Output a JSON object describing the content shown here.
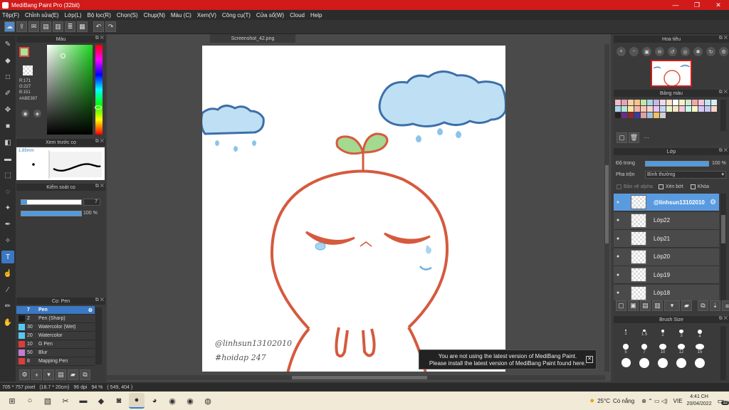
{
  "window": {
    "title": "MediBang Paint Pro (32bit)",
    "minimize": "—",
    "maximize": "❐",
    "close": "✕"
  },
  "menu": [
    "Tệp(F)",
    "Chỉnh sửa(E)",
    "Lớp(L)",
    "Bộ lọc(R)",
    "Chọn(S)",
    "Chụp(N)",
    "Màu (C)",
    "Xem(V)",
    "Công cụ(T)",
    "Cửa sổ(W)",
    "Cloud",
    "Help"
  ],
  "color_panel": {
    "title": "Màu",
    "r": "R:171",
    "g": "G:227",
    "b": "B:151",
    "hex": "#ABE397",
    "fg_color": "#abe397",
    "accent": "#e24b3b"
  },
  "brush_preview": {
    "title": "Xem trước cọ",
    "size": "1.85mm"
  },
  "brush_control": {
    "title": "Kiểm soát cọ",
    "size_value": "7",
    "size_fraction": 0.1,
    "opacity_value": "100 %",
    "opacity_fraction": 1.0
  },
  "brush_list": {
    "title": "Cọ: Pen",
    "items": [
      {
        "num": "7",
        "name": "Pen",
        "color": "#3b78c4",
        "selected": true
      },
      {
        "num": "2",
        "name": "Pen (Sharp)",
        "color": "#1a1a1a"
      },
      {
        "num": "30",
        "name": "Watercolor (Wet)",
        "color": "#57c7f0"
      },
      {
        "num": "20",
        "name": "Watercolor",
        "color": "#57c7f0"
      },
      {
        "num": "10",
        "name": "G Pen",
        "color": "#e03b3b"
      },
      {
        "num": "50",
        "name": "Blur",
        "color": "#c57bd6"
      },
      {
        "num": "8",
        "name": "Mapping Pen",
        "color": "#e03b3b"
      }
    ]
  },
  "canvas": {
    "tab": "Screenshot_42.png",
    "signature_1": "@linhsun13102010",
    "signature_2": "#hoidap 247"
  },
  "notification": {
    "line1": "You are not using the latest version of MediBang Paint.",
    "line2": "Please install the latest version of MediBang Paint found here.",
    "close": "✕"
  },
  "status": {
    "size": "705 * 757 pixel",
    "cm": "(18.7 * 20cm)",
    "dpi": "96 dpi",
    "zoom": "94 %",
    "coords": "( 549, 404 )"
  },
  "navigator": {
    "title": "Hoa tiêu"
  },
  "palette": {
    "title": "Bảng màu",
    "colors": [
      "#f5b8c4",
      "#e7a3b5",
      "#f6d2a6",
      "#f7c48a",
      "#c7e6a3",
      "#a8d8e8",
      "#c9b6e4",
      "#f2d9e6",
      "#fde3c8",
      "#ffffff",
      "#f6f0c8",
      "#cfe8d2",
      "#f4a7a7",
      "#f6c6d8",
      "#bfe3f2",
      "#d7eef6",
      "#a6d6e6",
      "#b6e6d6",
      "#fde6a6",
      "#f7b5a8",
      "#fac6b6",
      "#fad6c8",
      "#e6c6f6",
      "#c6d6f6",
      "#e6f6c6",
      "#f6e6c6",
      "#f7c7d7",
      "#c7f7e7",
      "#f7f7c7",
      "#d7c7f7",
      "#c7c7f7",
      "#f7d7c7",
      "#222222",
      "#6b2c8a",
      "#8c2a2a",
      "#3b3b9c",
      "#e0a0a0",
      "#a0c0e0",
      "#f0c060",
      "#d0d0d0"
    ],
    "more": "···"
  },
  "layers": {
    "title": "Lớp",
    "opacity_label": "Độ trong",
    "opacity_value": "100 %",
    "opacity_fraction": 1.0,
    "blend_label": "Pha trộn",
    "blend_value": "Bình thường",
    "protect_alpha": "Bảo vệ alpha",
    "clip": "Xén bớt",
    "lock": "Khóa",
    "items": [
      {
        "name": "@linhsun13102010",
        "selected": true
      },
      {
        "name": "Lớp22"
      },
      {
        "name": "Lớp21"
      },
      {
        "name": "Lớp20"
      },
      {
        "name": "Lớp19"
      },
      {
        "name": "Lớp18"
      }
    ]
  },
  "brush_size": {
    "title": "Brush Size",
    "sizes": [
      "1",
      "1.5",
      "2",
      "3",
      "4",
      "5",
      "7",
      "10",
      "12",
      "15",
      "",
      "",
      "",
      "",
      ""
    ]
  },
  "taskbar": {
    "weather_temp": "25°C",
    "weather_text": "Có nắng",
    "lang": "VIE",
    "time": "4:41 CH",
    "date": "20/04/2022",
    "notif_count": "12"
  }
}
